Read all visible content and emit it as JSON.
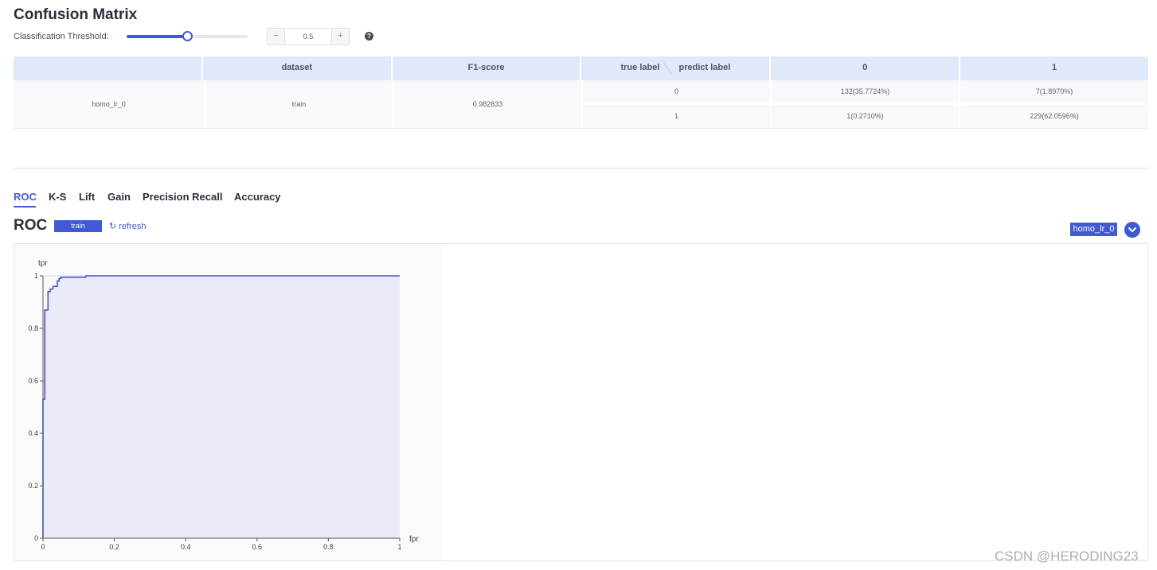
{
  "page": {
    "title": "Confusion Matrix"
  },
  "threshold": {
    "label": "Classification Threshold:",
    "value": "0.5",
    "slider_fraction": 0.5,
    "minus_label": "−",
    "plus_label": "+",
    "help_label": "?"
  },
  "confusion_table": {
    "headers": [
      "",
      "dataset",
      "F1-score",
      "true label",
      "predict label",
      "0",
      "1"
    ],
    "model": "homo_lr_0",
    "dataset": "train",
    "f1": "0.982833",
    "rows": [
      {
        "true_label": "0",
        "pred_0": "132(35.7724%)",
        "pred_1": "7(1.8970%)"
      },
      {
        "true_label": "1",
        "pred_0": "1(0.2710%)",
        "pred_1": "229(62.0596%)"
      }
    ]
  },
  "tabs": [
    "ROC",
    "K-S",
    "Lift",
    "Gain",
    "Precision Recall",
    "Accuracy"
  ],
  "active_tab": "ROC",
  "roc_section": {
    "title": "ROC",
    "dataset_chip": "train",
    "refresh_label": "refresh",
    "refresh_icon": "refresh-icon",
    "model_select": "homo_lr_0",
    "expand_icon": "chevron-down-icon"
  },
  "chart_data": {
    "type": "line",
    "title": "",
    "xlabel": "fpr",
    "ylabel": "tpr",
    "xlim": [
      0,
      1
    ],
    "ylim": [
      0,
      1
    ],
    "grid": true,
    "fill": "area under curve",
    "x_ticks": [
      "0",
      "0.2",
      "0.4",
      "0.6",
      "0.8",
      "1"
    ],
    "y_ticks": [
      "0",
      "0.2",
      "0.4",
      "0.6",
      "0.8",
      "1"
    ],
    "series": [
      {
        "x": [
          0,
          0,
          0.005,
          0.005,
          0.014,
          0.014,
          0.02,
          0.02,
          0.028,
          0.028,
          0.04,
          0.04,
          0.045,
          0.045,
          0.05,
          0.05,
          0.12,
          0.12,
          1
        ],
        "y": [
          0,
          0.53,
          0.53,
          0.87,
          0.87,
          0.94,
          0.94,
          0.95,
          0.95,
          0.96,
          0.96,
          0.98,
          0.98,
          0.99,
          0.99,
          0.995,
          0.995,
          1,
          1
        ]
      }
    ],
    "colors": {
      "line": "#4b58c9",
      "area": "#e9ebf8"
    }
  },
  "watermark": "CSDN @HERODING23"
}
